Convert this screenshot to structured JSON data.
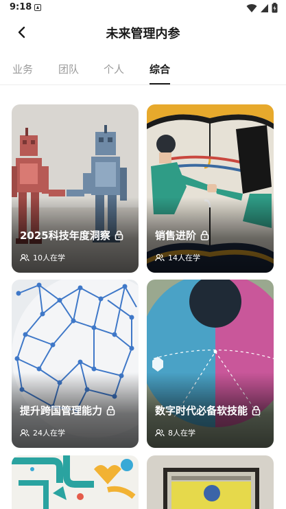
{
  "status": {
    "time": "9:18"
  },
  "header": {
    "title": "未来管理内参"
  },
  "tabs": [
    {
      "label": "业务"
    },
    {
      "label": "团队"
    },
    {
      "label": "个人"
    },
    {
      "label": "综合"
    }
  ],
  "active_tab": "综合",
  "cards": [
    {
      "title": "2025科技年度洞察",
      "learners": "10人在学"
    },
    {
      "title": "销售进阶",
      "learners": "14人在学"
    },
    {
      "title": "提升跨国管理能力",
      "learners": "24人在学"
    },
    {
      "title": "数字时代必备软技能",
      "learners": "8人在学"
    }
  ]
}
